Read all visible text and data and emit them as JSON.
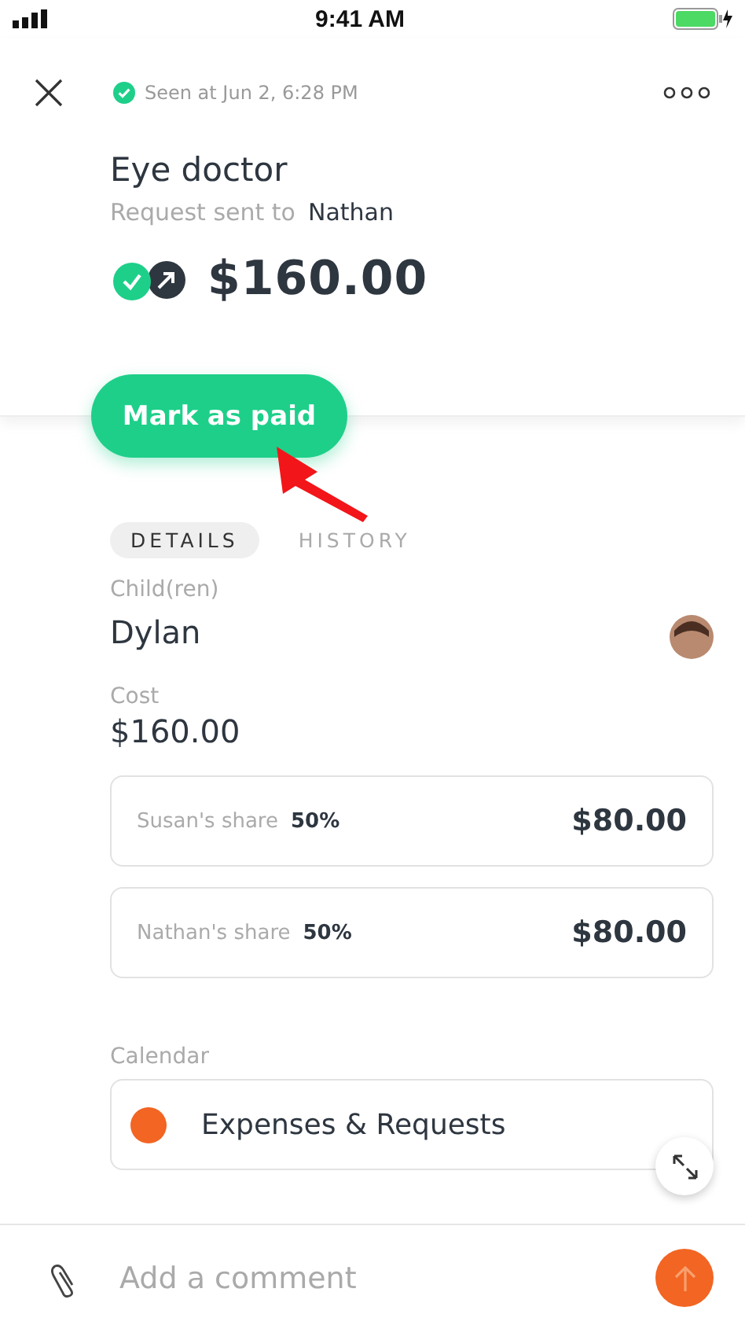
{
  "status_bar": {
    "time": "9:41 AM"
  },
  "header": {
    "seen": "Seen at Jun 2, 6:28 PM"
  },
  "request": {
    "title": "Eye doctor",
    "sent_label": "Request sent to",
    "recipient": "Nathan",
    "amount": "$160.00",
    "paid": true
  },
  "primary_button": "Mark as paid",
  "tabs": [
    {
      "label": "DETAILS",
      "selected": true
    },
    {
      "label": "HISTORY",
      "selected": false
    }
  ],
  "children": {
    "label": "Child(ren)",
    "value": "Dylan"
  },
  "cost": {
    "label": "Cost",
    "value": "$160.00"
  },
  "shares": [
    {
      "name": "Susan's share",
      "percent": "50%",
      "amount": "$80.00"
    },
    {
      "name": "Nathan's share",
      "percent": "50%",
      "amount": "$80.00"
    }
  ],
  "calendar": {
    "label": "Calendar",
    "name": "Expenses & Requests",
    "color": "#f26522"
  },
  "comment": {
    "placeholder": "Add a comment"
  }
}
